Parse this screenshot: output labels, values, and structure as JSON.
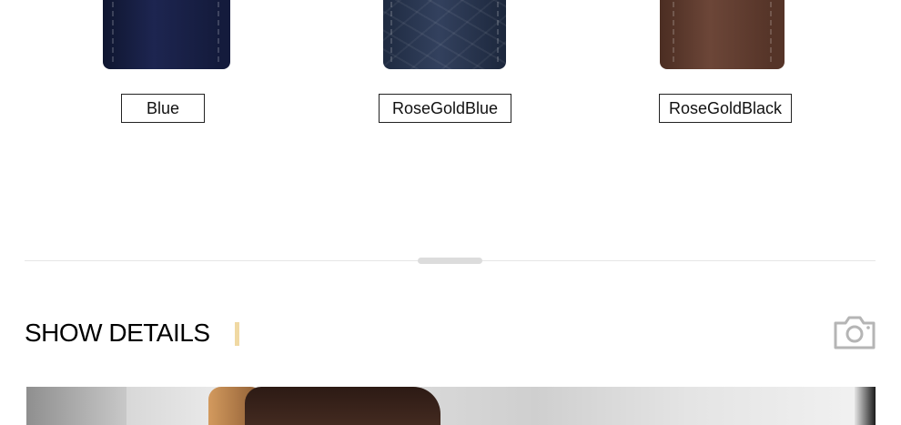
{
  "straps": [
    {
      "label": "Blue"
    },
    {
      "label": "RoseGoldBlue"
    },
    {
      "label": "RoseGoldBlack"
    }
  ],
  "section": {
    "title": "SHOW DETAILS",
    "accent_color": "#f0d9a3",
    "icon": "camera-icon"
  }
}
